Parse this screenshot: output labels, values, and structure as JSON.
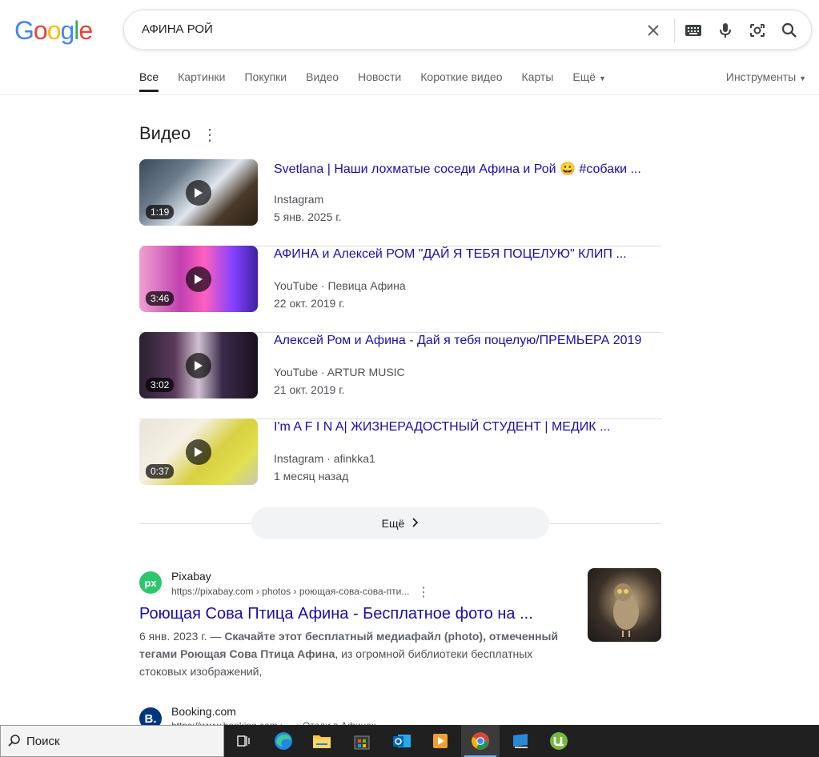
{
  "logo": "Google",
  "search": {
    "value": "АФИНА РОЙ"
  },
  "tabs": [
    "Все",
    "Картинки",
    "Покупки",
    "Видео",
    "Новости",
    "Короткие видео",
    "Карты",
    "Ещё"
  ],
  "tools_label": "Инструменты",
  "videos": {
    "heading": "Видео",
    "items": [
      {
        "title": "Svetlana | Наши лохматые соседи Афина и Рой 😀 #собаки ...",
        "source": "Instagram",
        "date": "5 янв. 2025 г.",
        "duration": "1:19"
      },
      {
        "title": "АФИНА и Алексей РОМ \"ДАЙ Я ТЕБЯ ПОЦЕЛУЮ\" КЛИП ...",
        "source": "YouTube · Певица Афина",
        "date": "22 окт. 2019 г.",
        "duration": "3:46"
      },
      {
        "title": "Алексей Ром и Афина - Дай я тебя поцелую/ПРЕМЬЕРА 2019",
        "source": "YouTube · ARTUR MUSIC",
        "date": "21 окт. 2019 г.",
        "duration": "3:02"
      },
      {
        "title": "I'm A F I N A| ЖИЗНЕРАДОСТНЫЙ СТУДЕНТ | МЕДИК ...",
        "source": "Instagram · afinkka1",
        "date": "1 месяц назад",
        "duration": "0:37"
      }
    ],
    "more_label": "Ещё"
  },
  "result1": {
    "site_name": "Pixabay",
    "favicon_text": "px",
    "url": "https://pixabay.com › photos › роющая-сова-сова-пти...",
    "title": "Роющая Сова Птица Афина - Бесплатное фото на ...",
    "date": "6 янв. 2023 г. —",
    "snippet_bold": "Скачайте этот бесплатный медиафайл (photo), отмеченный тегами Роющая Сова Птица Афина",
    "snippet_rest": ", из огромной библиотеки бесплатных стоковых изображений,"
  },
  "result2": {
    "site_name": "Booking.com",
    "favicon_text": "B.",
    "url": "https://www.booking.com › ... › Отели в Афинах"
  },
  "taskbar": {
    "search_placeholder": "Поиск"
  }
}
